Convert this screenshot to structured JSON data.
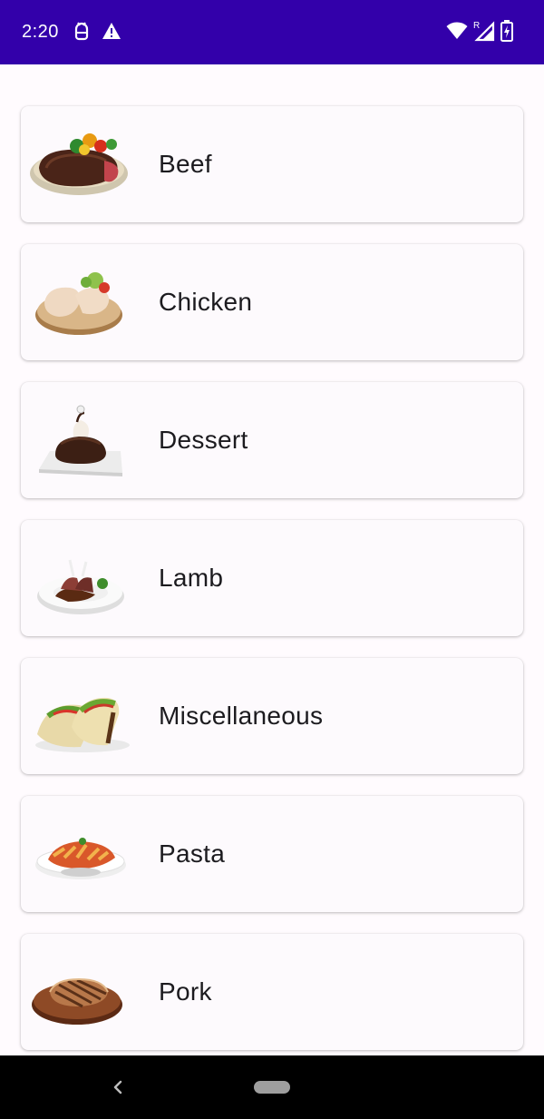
{
  "status_bar": {
    "time": "2:20",
    "background": "#3300aa",
    "left_icons": [
      "android-debug-icon",
      "warning-icon"
    ],
    "right_icons": [
      "wifi-icon",
      "signal-roaming-icon",
      "battery-charging-icon"
    ],
    "roaming_indicator": "R"
  },
  "categories": [
    {
      "label": "Beef",
      "icon": "steak-plate-icon"
    },
    {
      "label": "Chicken",
      "icon": "chicken-board-icon"
    },
    {
      "label": "Dessert",
      "icon": "chocolate-cake-icon"
    },
    {
      "label": "Lamb",
      "icon": "lamb-chops-icon"
    },
    {
      "label": "Miscellaneous",
      "icon": "tacos-icon"
    },
    {
      "label": "Pasta",
      "icon": "pasta-plate-icon"
    },
    {
      "label": "Pork",
      "icon": "pork-chop-board-icon"
    }
  ],
  "nav_bar": {
    "icons": [
      "back-icon",
      "home-pill-icon"
    ]
  }
}
